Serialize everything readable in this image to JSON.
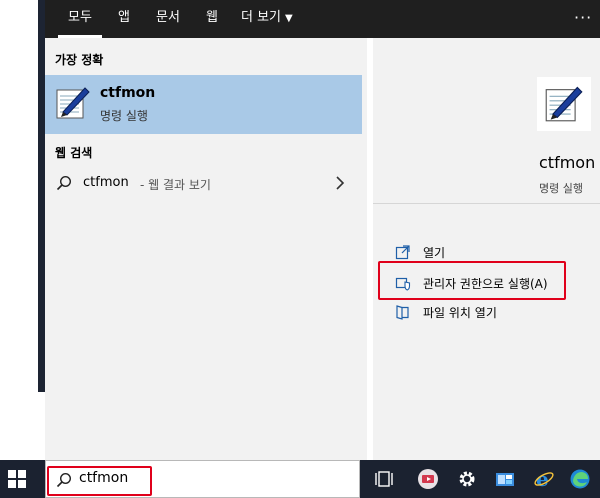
{
  "tabs": [
    {
      "label": "모두",
      "active": true
    },
    {
      "label": "앱",
      "active": false
    },
    {
      "label": "문서",
      "active": false
    },
    {
      "label": "웹",
      "active": false
    },
    {
      "label": "더 보기",
      "active": false
    }
  ],
  "more_options_icon": "ellipsis-icon",
  "best_match": {
    "heading": "가장 정확",
    "name": "ctfmon",
    "subtitle": "명령 실행"
  },
  "web_search": {
    "heading": "웹 검색",
    "term": "ctfmon",
    "suffix": "- 웹 결과 보기"
  },
  "detail": {
    "name": "ctfmon",
    "subtitle": "명령 실행",
    "actions": [
      {
        "label": "열기",
        "icon": "open-icon"
      },
      {
        "label": "관리자 권한으로 실행(A)",
        "icon": "shield-admin-icon",
        "highlighted": true
      },
      {
        "label": "파일 위치 열기",
        "icon": "folder-location-icon"
      }
    ]
  },
  "search": {
    "value": "ctfmon",
    "highlighted": true
  },
  "taskbar_icons": [
    "task-view-icon",
    "media-app-icon",
    "gear-icon",
    "store-icon",
    "internet-explorer-icon",
    "edge-icon"
  ],
  "colors": {
    "selected_bg": "#a9c9e7",
    "highlight_border": "#e0001b",
    "taskbar_bg": "#1b2230",
    "topbar_bg": "#1f1f1f"
  }
}
